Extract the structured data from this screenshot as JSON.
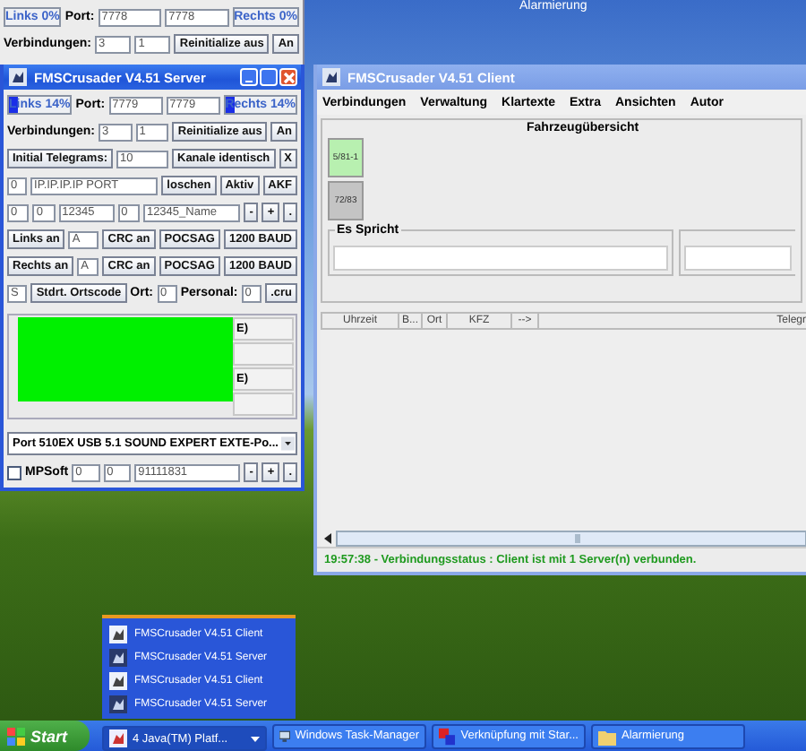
{
  "background_window": {
    "title": "Alarmierung"
  },
  "server_back": {
    "lines": [
      {
        "controls": [
          {
            "kind": "meter",
            "text": "Links 0%",
            "level": 0
          },
          {
            "kind": "label",
            "text": "Port:"
          },
          {
            "kind": "field",
            "text": "7778"
          },
          {
            "kind": "field",
            "text": "7778"
          },
          {
            "kind": "meter",
            "text": "Rechts 0%",
            "level": 0
          }
        ]
      },
      {
        "controls": [
          {
            "kind": "label",
            "text": "Verbindungen:"
          },
          {
            "kind": "field",
            "text": "3"
          },
          {
            "kind": "field",
            "text": "1"
          },
          {
            "kind": "button",
            "text": "Reinitialize aus"
          },
          {
            "kind": "button",
            "text": "An"
          }
        ]
      }
    ]
  },
  "server": {
    "title": "FMSCrusader V4.51 Server",
    "lines": [
      {
        "controls": [
          {
            "kind": "meter",
            "text": "Links 14%",
            "level": 0.14
          },
          {
            "kind": "label",
            "text": "Port:"
          },
          {
            "kind": "field",
            "text": "7779"
          },
          {
            "kind": "field",
            "text": "7779"
          },
          {
            "kind": "meter",
            "text": "Rechts 14%",
            "level": 0.14
          }
        ]
      },
      {
        "controls": [
          {
            "kind": "label",
            "text": "Verbindungen:"
          },
          {
            "kind": "field",
            "text": "3"
          },
          {
            "kind": "field",
            "text": "1"
          },
          {
            "kind": "button",
            "text": "Reinitialize aus"
          },
          {
            "kind": "button",
            "text": "An"
          }
        ]
      },
      {
        "controls": [
          {
            "kind": "button",
            "text": "Initial Telegrams:"
          },
          {
            "kind": "field",
            "text": "10"
          },
          {
            "kind": "button",
            "text": "Kanale identisch"
          },
          {
            "kind": "button",
            "text": "X"
          }
        ]
      },
      {
        "controls": [
          {
            "kind": "field",
            "text": "0"
          },
          {
            "kind": "field",
            "text": "IP.IP.IP.IP PORT"
          },
          {
            "kind": "button",
            "text": "loschen"
          },
          {
            "kind": "button",
            "text": "Aktiv"
          },
          {
            "kind": "button",
            "text": "AKF"
          }
        ]
      },
      {
        "controls": [
          {
            "kind": "field",
            "text": "0"
          },
          {
            "kind": "field",
            "text": "0"
          },
          {
            "kind": "field",
            "text": "12345"
          },
          {
            "kind": "field",
            "text": "0"
          },
          {
            "kind": "field",
            "text": "12345_Name"
          },
          {
            "kind": "button",
            "text": "-"
          },
          {
            "kind": "button",
            "text": "+"
          },
          {
            "kind": "button",
            "text": "."
          }
        ]
      },
      {
        "controls": [
          {
            "kind": "button",
            "text": "Links an"
          },
          {
            "kind": "field",
            "text": "A"
          },
          {
            "kind": "button",
            "text": "CRC an"
          },
          {
            "kind": "button",
            "text": "POCSAG"
          },
          {
            "kind": "button",
            "text": "1200 BAUD"
          }
        ]
      },
      {
        "controls": [
          {
            "kind": "button",
            "text": "Rechts an"
          },
          {
            "kind": "field",
            "text": "A"
          },
          {
            "kind": "button",
            "text": "CRC an"
          },
          {
            "kind": "button",
            "text": "POCSAG"
          },
          {
            "kind": "button",
            "text": "1200 BAUD"
          }
        ]
      },
      {
        "controls": [
          {
            "kind": "field",
            "text": "S"
          },
          {
            "kind": "button",
            "text": "Stdrt. Ortscode"
          },
          {
            "kind": "label",
            "text": "Ort:"
          },
          {
            "kind": "field",
            "text": "0"
          },
          {
            "kind": "label",
            "text": "Personal:"
          },
          {
            "kind": "field",
            "text": "0"
          },
          {
            "kind": "button",
            "text": ".cru"
          }
        ]
      }
    ],
    "list": {
      "covered": true,
      "rows": [
        {
          "text": "E)"
        },
        {
          "text": null
        },
        {
          "text": "E)"
        },
        {
          "text": null
        }
      ]
    },
    "device_select": {
      "value": "Port 510EX USB 5.1 SOUND EXPERT EXTE-Po..."
    },
    "bottom_row": [
      {
        "kind": "checkbox",
        "text": "MPSoft",
        "checked": false
      },
      {
        "kind": "field",
        "text": "0"
      },
      {
        "kind": "field",
        "text": "0"
      },
      {
        "kind": "field",
        "text": "91111831"
      },
      {
        "kind": "button",
        "text": "-"
      },
      {
        "kind": "button",
        "text": "+"
      },
      {
        "kind": "button",
        "text": "."
      }
    ]
  },
  "client": {
    "title": "FMSCrusader V4.51 Client",
    "menu": [
      "Verbindungen",
      "Verwaltung",
      "Klartexte",
      "Extra",
      "Ansichten",
      "Autor"
    ],
    "overview_title": "Fahrzeugübersicht",
    "vehicles": [
      {
        "label": "5/81-1",
        "color": "#b8f0b0"
      },
      {
        "label": "72/83",
        "color": "#c4c4c4"
      }
    ],
    "speaker_panel": {
      "title": "Es Spricht"
    },
    "columns": [
      "Uhrzeit",
      "B...",
      "Ort",
      "KFZ",
      "-->",
      "Telegr"
    ],
    "status": "19:57:38 - Verbindungsstatus : Client ist mit 1 Server(n) verbunden."
  },
  "taskbar_menu": [
    {
      "label": "FMSCrusader V4.51 Client",
      "kind": "client"
    },
    {
      "label": "FMSCrusader V4.51 Server",
      "kind": "server"
    },
    {
      "label": "FMSCrusader V4.51 Client",
      "kind": "client"
    },
    {
      "label": "FMSCrusader V4.51 Server",
      "kind": "server"
    }
  ],
  "taskbar": {
    "start": "Start",
    "buttons": [
      {
        "label": "4 Java(TM) Platf...",
        "kind": "group",
        "selected": true
      },
      {
        "label": "Windows Task-Manager",
        "kind": "taskmgr",
        "selected": false
      },
      {
        "label": "Verknüpfung mit Star...",
        "kind": "shortcut",
        "selected": false
      },
      {
        "label": "Alarmierung",
        "kind": "folder",
        "selected": false
      }
    ]
  }
}
